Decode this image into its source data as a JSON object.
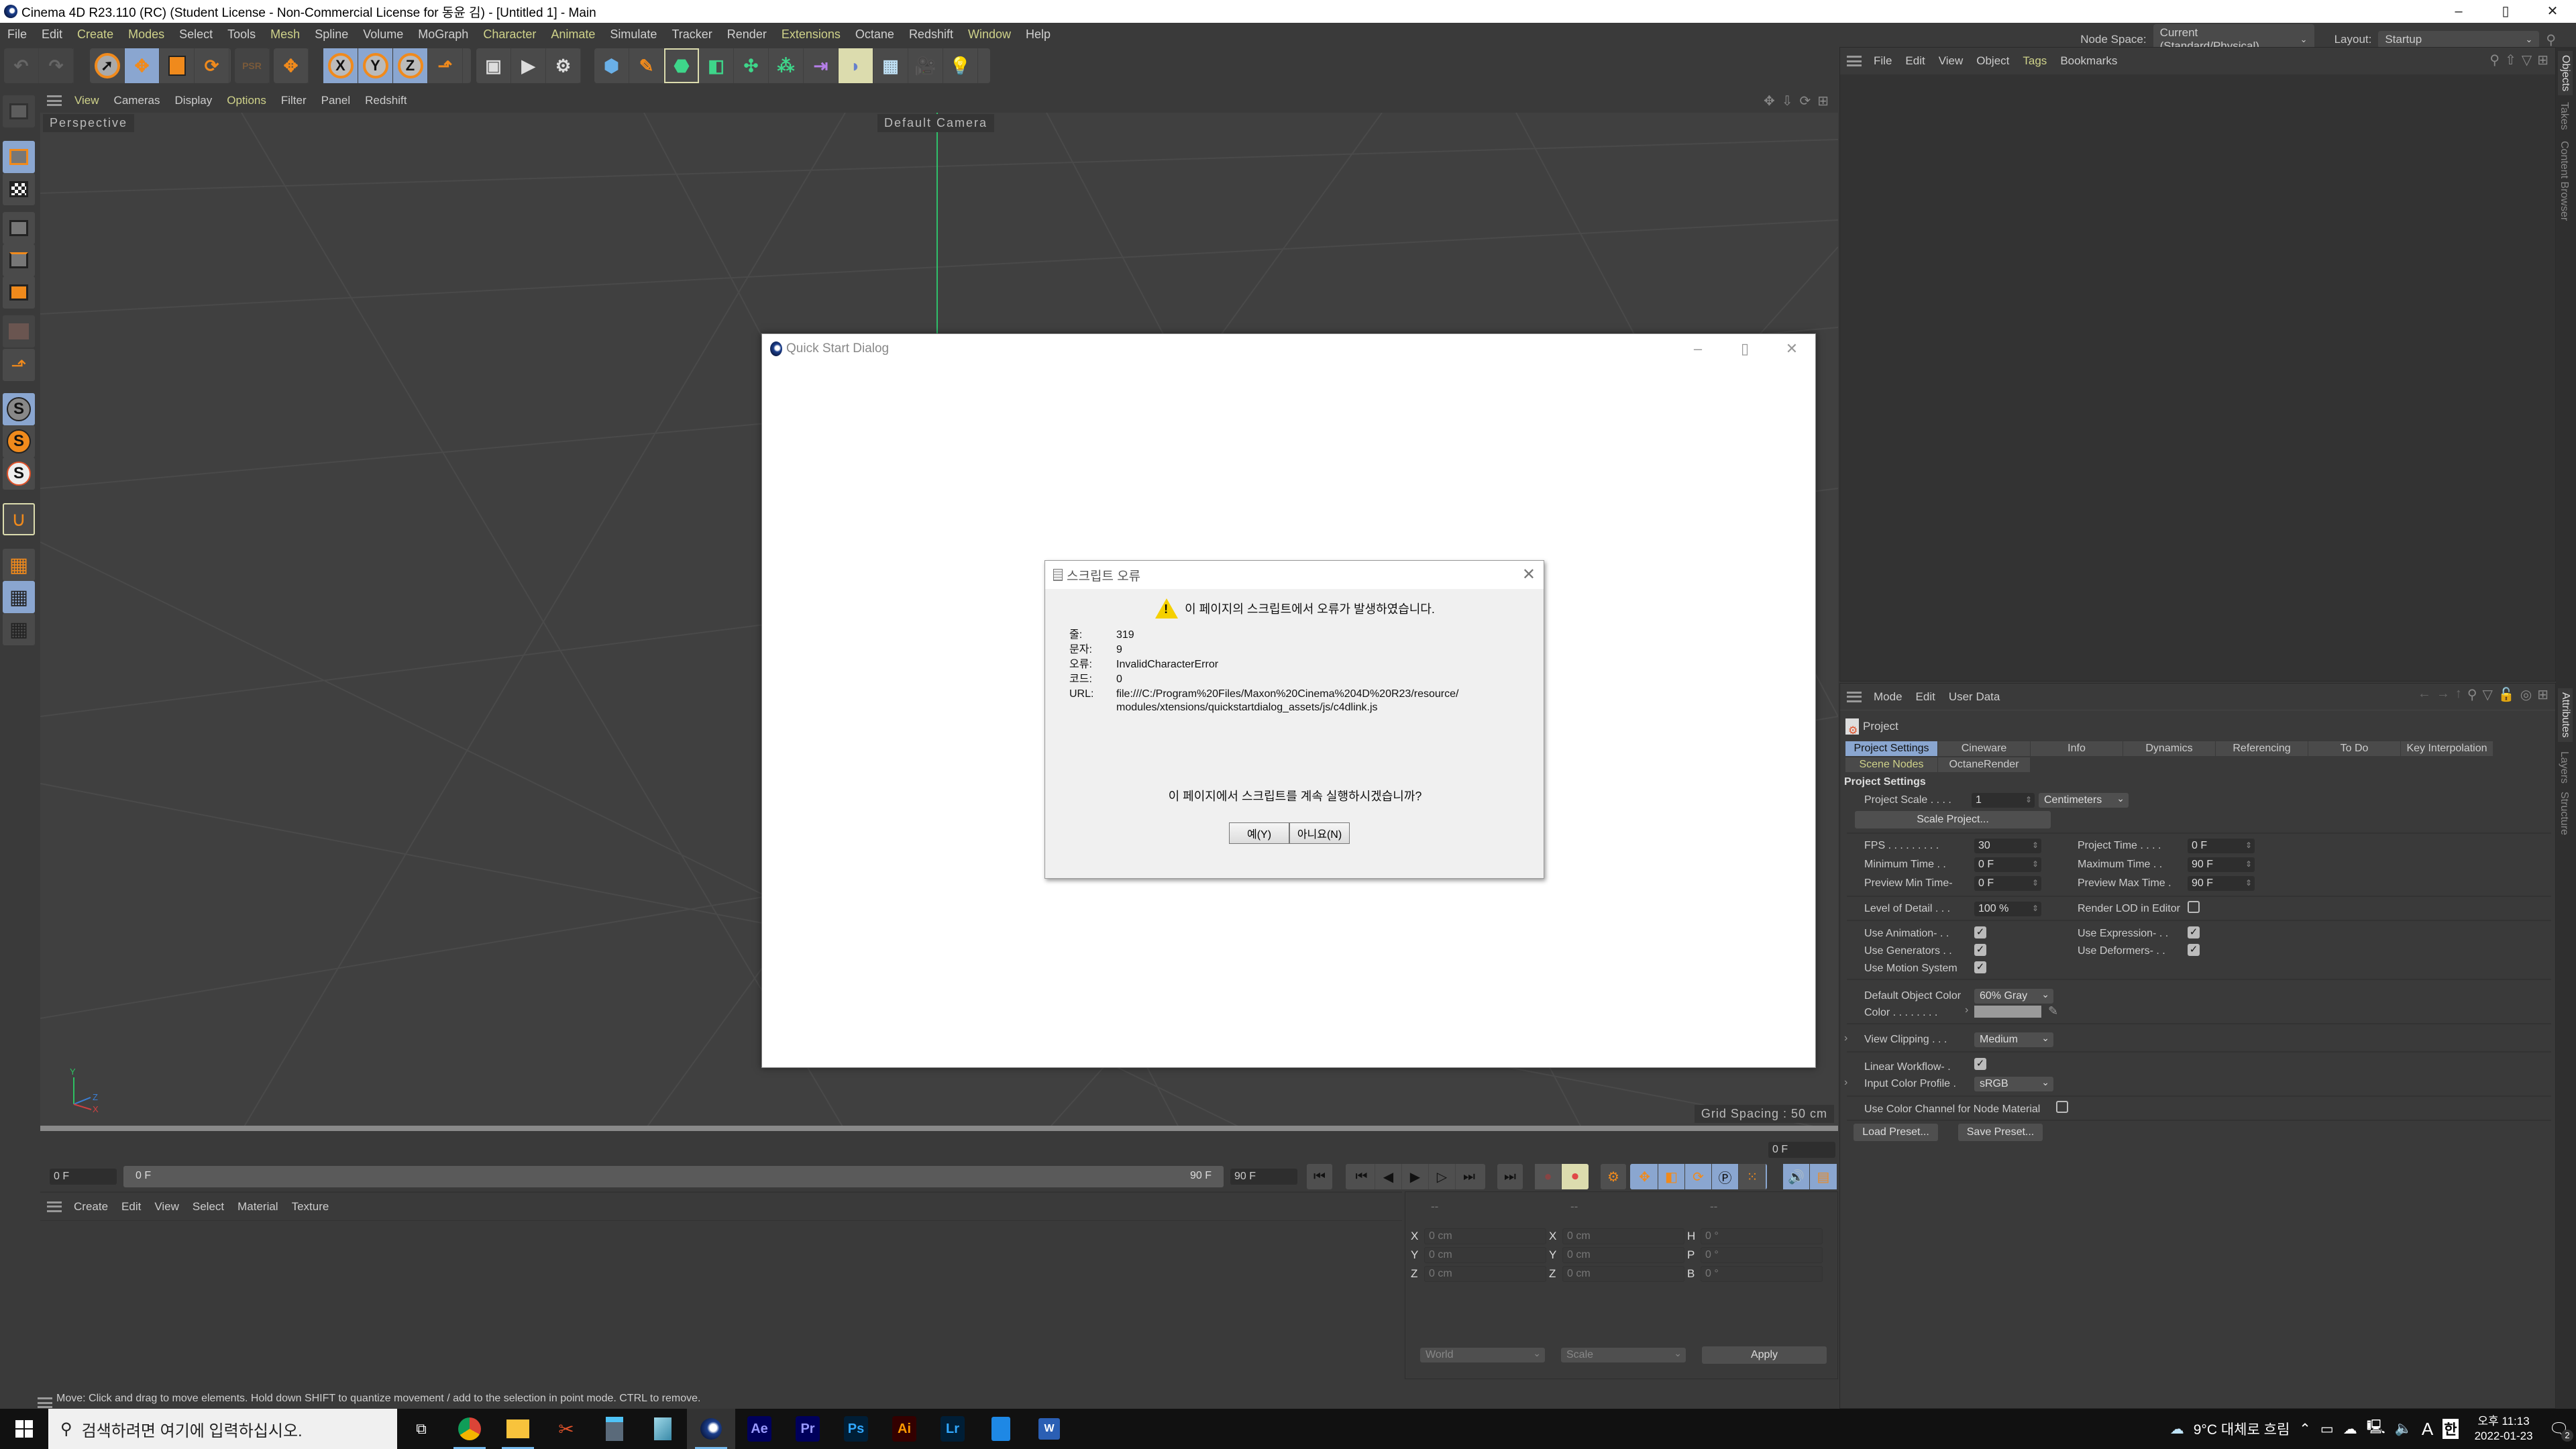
{
  "window": {
    "title": "Cinema 4D R23.110 (RC) (Student License - Non-Commercial License for 동윤 김) - [Untitled 1] - Main",
    "controls": {
      "minimize": "–",
      "maximize": "▯",
      "close": "✕"
    }
  },
  "menubar": {
    "items": [
      {
        "label": "File",
        "highlight": false
      },
      {
        "label": "Edit",
        "highlight": false
      },
      {
        "label": "Create",
        "highlight": true
      },
      {
        "label": "Modes",
        "highlight": true
      },
      {
        "label": "Select",
        "highlight": false
      },
      {
        "label": "Tools",
        "highlight": false
      },
      {
        "label": "Mesh",
        "highlight": true
      },
      {
        "label": "Spline",
        "highlight": false
      },
      {
        "label": "Volume",
        "highlight": false
      },
      {
        "label": "MoGraph",
        "highlight": false
      },
      {
        "label": "Character",
        "highlight": true
      },
      {
        "label": "Animate",
        "highlight": true
      },
      {
        "label": "Simulate",
        "highlight": false
      },
      {
        "label": "Tracker",
        "highlight": false
      },
      {
        "label": "Render",
        "highlight": false
      },
      {
        "label": "Extensions",
        "highlight": true
      },
      {
        "label": "Octane",
        "highlight": false
      },
      {
        "label": "Redshift",
        "highlight": false
      },
      {
        "label": "Window",
        "highlight": true
      },
      {
        "label": "Help",
        "highlight": false
      }
    ],
    "node_space_label": "Node Space:",
    "node_space_value": "Current (Standard/Physical)",
    "layout_label": "Layout:",
    "layout_value": "Startup"
  },
  "toolbar": {
    "icons": [
      "undo-icon",
      "redo-icon",
      "live-selection-icon",
      "move-icon",
      "scale-icon",
      "rotate-icon",
      "psr-icon",
      "world-axis-icon",
      "x-axis-lock-icon",
      "y-axis-lock-icon",
      "z-axis-lock-icon",
      "coordinate-system-icon",
      "render-view-icon",
      "render-picture-viewer-icon",
      "render-settings-icon",
      "cube-icon",
      "pen-icon",
      "subdivision-icon",
      "extrude-icon",
      "cloner-icon",
      "mograph-icon",
      "bend-icon",
      "deformer-icon",
      "floor-icon",
      "camera-icon",
      "light-icon"
    ],
    "axis_labels": [
      "X",
      "Y",
      "Z"
    ]
  },
  "viewport": {
    "menu": [
      {
        "label": "View",
        "highlight": true
      },
      {
        "label": "Cameras",
        "highlight": false
      },
      {
        "label": "Display",
        "highlight": false
      },
      {
        "label": "Options",
        "highlight": true
      },
      {
        "label": "Filter",
        "highlight": false
      },
      {
        "label": "Panel",
        "highlight": false
      },
      {
        "label": "Redshift",
        "highlight": false
      }
    ],
    "view_name": "Perspective",
    "camera_name": "Default Camera",
    "grid_spacing": "Grid Spacing : 50 cm",
    "axis": {
      "x": "X",
      "y": "Y",
      "z": "Z"
    }
  },
  "quick_start_dialog": {
    "title": "Quick Start Dialog"
  },
  "script_error": {
    "title": "스크립트 오류",
    "header": "이 페이지의 스크립트에서 오류가 발생하였습니다.",
    "fields": [
      {
        "key": "줄:",
        "value": "319"
      },
      {
        "key": "문자:",
        "value": "9"
      },
      {
        "key": "오류:",
        "value": "InvalidCharacterError"
      },
      {
        "key": "코드:",
        "value": "0"
      },
      {
        "key": "URL:",
        "value": "file:///C:/Program%20Files/Maxon%20Cinema%204D%20R23/resource/modules/xtensions/quickstartdialog_assets/js/c4dlink.js"
      }
    ],
    "question": "이 페이지에서 스크립트를 계속 실행하시겠습니까?",
    "yes_label": "예(Y)",
    "no_label": "아니요(N)"
  },
  "object_manager": {
    "menu": [
      {
        "label": "File",
        "highlight": false
      },
      {
        "label": "Edit",
        "highlight": false
      },
      {
        "label": "View",
        "highlight": false
      },
      {
        "label": "Object",
        "highlight": false
      },
      {
        "label": "Tags",
        "highlight": true
      },
      {
        "label": "Bookmarks",
        "highlight": false
      }
    ]
  },
  "side_tabs": {
    "top": [
      "Objects",
      "Takes",
      "Content Browser"
    ],
    "bottom": [
      "Attributes",
      "Layers",
      "Structure"
    ]
  },
  "attributes": {
    "menu": [
      "Mode",
      "Edit",
      "User Data"
    ],
    "object_name": "Project",
    "tabs_row1": [
      "Project Settings",
      "Cineware",
      "Info",
      "Dynamics",
      "Referencing",
      "To Do",
      "Key Interpolation"
    ],
    "tabs_row2": [
      "Scene Nodes",
      "OctaneRender"
    ],
    "active_tab": "Project Settings",
    "section_title": "Project Settings",
    "project_scale_label": "Project Scale . . . .",
    "project_scale_value": "1",
    "project_scale_unit": "Centimeters",
    "scale_project_button": "Scale Project...",
    "fps_label": "FPS . . . . . . . . .",
    "fps_value": "30",
    "project_time_label": "Project Time . . . .",
    "project_time_value": "0 F",
    "min_time_label": "Minimum Time . .",
    "min_time_value": "0 F",
    "max_time_label": "Maximum Time . .",
    "max_time_value": "90 F",
    "preview_min_label": "Preview Min Time-",
    "preview_min_value": "0 F",
    "preview_max_label": "Preview Max Time .",
    "preview_max_value": "90 F",
    "lod_label": "Level of Detail . . .",
    "lod_value": "100 %",
    "render_lod_label": "Render LOD in Editor",
    "render_lod_checked": false,
    "use_animation_label": "Use Animation- . .",
    "use_animation_checked": true,
    "use_expression_label": "Use Expression- . .",
    "use_expression_checked": true,
    "use_generators_label": "Use Generators . .",
    "use_generators_checked": true,
    "use_deformers_label": "Use Deformers- . .",
    "use_deformers_checked": true,
    "use_motion_label": "Use Motion System",
    "use_motion_checked": true,
    "default_color_label": "Default Object Color",
    "default_color_value": "60% Gray",
    "color_label": "Color . . . . . . . .",
    "color_swatch": "#9a9a9a",
    "view_clipping_label": "View Clipping . . .",
    "view_clipping_value": "Medium",
    "linear_workflow_label": "Linear Workflow- .",
    "linear_workflow_checked": true,
    "input_profile_label": "Input Color Profile .",
    "input_profile_value": "sRGB",
    "node_material_label": "Use Color Channel for Node Material",
    "node_material_checked": false,
    "load_preset": "Load Preset...",
    "save_preset": "Save Preset..."
  },
  "timeline": {
    "start_field": "0 F",
    "range_start": "0 F",
    "range_end": "90 F",
    "end_field": "90 F",
    "current_frame": "0 F"
  },
  "material_manager": {
    "menu": [
      "Create",
      "Edit",
      "View",
      "Select",
      "Material",
      "Texture"
    ]
  },
  "coordinates": {
    "headers": [
      "--",
      "--",
      "--"
    ],
    "position": [
      {
        "axis": "X",
        "value": "0 cm"
      },
      {
        "axis": "Y",
        "value": "0 cm"
      },
      {
        "axis": "Z",
        "value": "0 cm"
      }
    ],
    "size": [
      {
        "axis": "X",
        "value": "0 cm"
      },
      {
        "axis": "Y",
        "value": "0 cm"
      },
      {
        "axis": "Z",
        "value": "0 cm"
      }
    ],
    "rotation": [
      {
        "axis": "H",
        "value": "0 °"
      },
      {
        "axis": "P",
        "value": "0 °"
      },
      {
        "axis": "B",
        "value": "0 °"
      }
    ],
    "mode": "World",
    "size_mode": "Scale",
    "apply": "Apply"
  },
  "status_bar": {
    "text": "Move: Click and drag to move elements. Hold down SHIFT to quantize movement / add to the selection in point mode. CTRL to remove."
  },
  "taskbar": {
    "search_placeholder": "검색하려면 여기에 입력하십시오.",
    "apps": [
      "task-view",
      "chrome",
      "file-explorer",
      "snipping-tool",
      "calculator",
      "notepad",
      "cinema4d",
      "after-effects",
      "premiere",
      "photoshop",
      "illustrator",
      "lightroom",
      "hancom",
      "word"
    ],
    "adobe": [
      {
        "label": "Ae",
        "bg": "#00005b",
        "fg": "#9999ff"
      },
      {
        "label": "Pr",
        "bg": "#00005b",
        "fg": "#9999ff"
      },
      {
        "label": "Ps",
        "bg": "#001e36",
        "fg": "#31a8ff"
      },
      {
        "label": "Ai",
        "bg": "#330000",
        "fg": "#ff9a00"
      },
      {
        "label": "Lr",
        "bg": "#001e36",
        "fg": "#31a8ff"
      }
    ],
    "weather": "9°C 대체로 흐림",
    "ime_mode": "A",
    "ime_lang": "한",
    "time": "오후 11:13",
    "date": "2022-01-23",
    "notifications": "2"
  }
}
